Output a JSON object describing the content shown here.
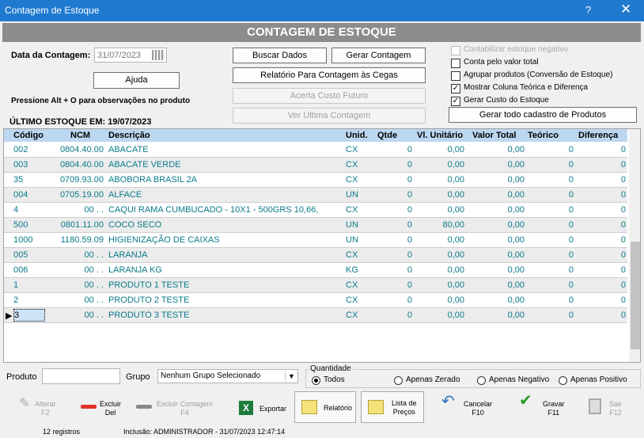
{
  "window": {
    "title": "Contagem de Estoque",
    "help": "?",
    "close": "✕"
  },
  "header": {
    "title": "CONTAGEM DE ESTOQUE"
  },
  "form": {
    "date_label": "Data da Contagem:",
    "date_value": "31/07/2023",
    "help_button": "Ajuda",
    "hint": "Pressione Alt + O para observações no produto",
    "last_stock": "ÚLTIMO ESTOQUE EM: 19/07/2023"
  },
  "actions": {
    "buscar": "Buscar Dados",
    "gerar_contagem": "Gerar Contagem",
    "relatorio_cegas": "Relatório Para Contagem às Cegas",
    "acerta_custo": "Acerta Custo Futuro",
    "ver_ultima": "Ver Última Contagem",
    "gerar_todo": "Gerar todo cadastro de Produtos"
  },
  "options": [
    {
      "label": "Contabilizar estoque negativo",
      "checked": false,
      "disabled": true
    },
    {
      "label": "Conta pelo valor total",
      "checked": false,
      "disabled": false
    },
    {
      "label": "Agrupar produtos (Conversão de Estoque)",
      "checked": false,
      "disabled": false
    },
    {
      "label": "Mostrar Coluna Teórica e Diferença",
      "checked": true,
      "disabled": false
    },
    {
      "label": "Gerar Custo do Estoque",
      "checked": true,
      "disabled": false
    }
  ],
  "table": {
    "columns": [
      "Código",
      "NCM",
      "Descrição",
      "Unid.",
      "Qtde",
      "Vl. Unitário",
      "Valor Total",
      "Teórico",
      "Diferença"
    ],
    "rows": [
      [
        "002",
        "0804.40.00",
        "ABACATE",
        "CX",
        "0",
        "0,00",
        "0,00",
        "0",
        "0"
      ],
      [
        "003",
        "0804.40.00",
        "ABACATE VERDE",
        "CX",
        "0",
        "0,00",
        "0,00",
        "0",
        "0"
      ],
      [
        "35",
        "0709.93.00",
        "ABOBORA BRASIL 2A",
        "CX",
        "0",
        "0,00",
        "0,00",
        "0",
        "0"
      ],
      [
        "004",
        "0705.19.00",
        "ALFACE",
        "UN",
        "0",
        "0,00",
        "0,00",
        "0",
        "0"
      ],
      [
        "4",
        "00 .  .",
        "CAQUI RAMA CUMBUCADO - 10X1 - 500GRS 10,66,",
        "CX",
        "0",
        "0,00",
        "0,00",
        "0",
        "0"
      ],
      [
        "500",
        "0801.11.00",
        "COCO SECO",
        "UN",
        "0",
        "80,00",
        "0,00",
        "0",
        "0"
      ],
      [
        "1000",
        "1180.59.09",
        "HIGIENIZAÇÃO DE CAIXAS",
        "UN",
        "0",
        "0,00",
        "0,00",
        "0",
        "0"
      ],
      [
        "005",
        "00 .  .",
        "LARANJA",
        "CX",
        "0",
        "0,00",
        "0,00",
        "0",
        "0"
      ],
      [
        "006",
        "00 .  .",
        "LARANJA KG",
        "KG",
        "0",
        "0,00",
        "0,00",
        "0",
        "0"
      ],
      [
        "1",
        "00 .  .",
        "PRODUTO 1 TESTE",
        "CX",
        "0",
        "0,00",
        "0,00",
        "0",
        "0"
      ],
      [
        "2",
        "00 .  .",
        "PRODUTO 2 TESTE",
        "CX",
        "0",
        "0,00",
        "0,00",
        "0",
        "0"
      ],
      [
        "3",
        "00 .  .",
        "PRODUTO 3 TESTE",
        "CX",
        "0",
        "0,00",
        "0,00",
        "0",
        "0"
      ]
    ]
  },
  "filter": {
    "produto_label": "Produto",
    "grupo_label": "Grupo",
    "grupo_value": "Nenhum Grupo Selecionado",
    "quantidade_label": "Quantidade",
    "radios": [
      "Todos",
      "Apenas Zerado",
      "Apenas Negativo",
      "Apenas Positivo"
    ]
  },
  "toolbar": [
    {
      "label": "Alterar\nF2"
    },
    {
      "label": "Excluir\nDel"
    },
    {
      "label": "Excluir Contagem\nF4"
    },
    {
      "label": "Exportar"
    },
    {
      "label": "Relatório"
    },
    {
      "label": "Lista de\nPreços"
    },
    {
      "label": "Cancelar\nF10"
    },
    {
      "label": "Gravar\nF11"
    },
    {
      "label": "Sair\nF12"
    }
  ],
  "status": {
    "records": "12 registros",
    "inclusion": "Inclusão: ADMINISTRADOR - 31/07/2023 12:47:14"
  }
}
